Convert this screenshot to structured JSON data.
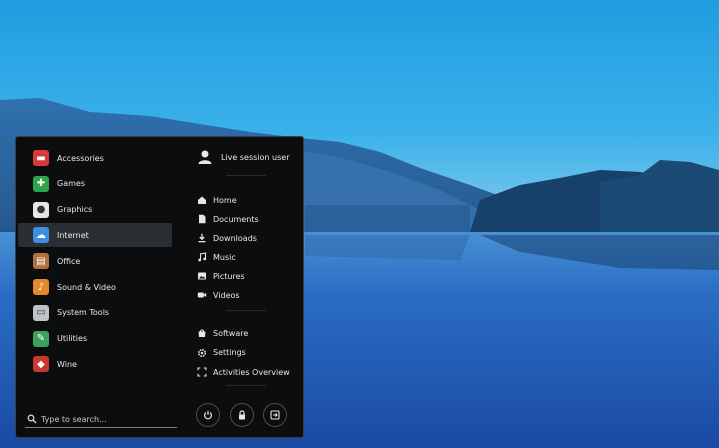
{
  "categories": [
    {
      "label": "Accessories",
      "icon": "accessories-icon",
      "color": "#d83a3a",
      "active": false
    },
    {
      "label": "Games",
      "icon": "gamepad-icon",
      "color": "#2fa44a",
      "active": false
    },
    {
      "label": "Graphics",
      "icon": "palette-icon",
      "color": "#e6e6e6",
      "active": false
    },
    {
      "label": "Internet",
      "icon": "cloud-icon",
      "color": "#3d8fe0",
      "active": true
    },
    {
      "label": "Office",
      "icon": "office-icon",
      "color": "#b0713a",
      "active": false
    },
    {
      "label": "Sound & Video",
      "icon": "media-icon",
      "color": "#e08a2a",
      "active": false
    },
    {
      "label": "System Tools",
      "icon": "monitor-icon",
      "color": "#bfc3c8",
      "active": false
    },
    {
      "label": "Utilities",
      "icon": "utilities-icon",
      "color": "#3aa05a",
      "active": false
    },
    {
      "label": "Wine",
      "icon": "wine-icon",
      "color": "#c8392f",
      "active": false
    }
  ],
  "search": {
    "placeholder": "Type to search..."
  },
  "user": {
    "name": "Live session user"
  },
  "places": [
    {
      "label": "Home",
      "icon": "home-icon"
    },
    {
      "label": "Documents",
      "icon": "document-icon"
    },
    {
      "label": "Downloads",
      "icon": "download-icon"
    },
    {
      "label": "Music",
      "icon": "music-icon"
    },
    {
      "label": "Pictures",
      "icon": "picture-icon"
    },
    {
      "label": "Videos",
      "icon": "video-icon"
    }
  ],
  "system": [
    {
      "label": "Software",
      "icon": "software-icon"
    },
    {
      "label": "Settings",
      "icon": "settings-icon"
    },
    {
      "label": "Activities Overview",
      "icon": "activities-icon"
    }
  ],
  "actions": [
    {
      "icon": "power-icon"
    },
    {
      "icon": "lock-icon"
    },
    {
      "icon": "logout-icon"
    }
  ]
}
